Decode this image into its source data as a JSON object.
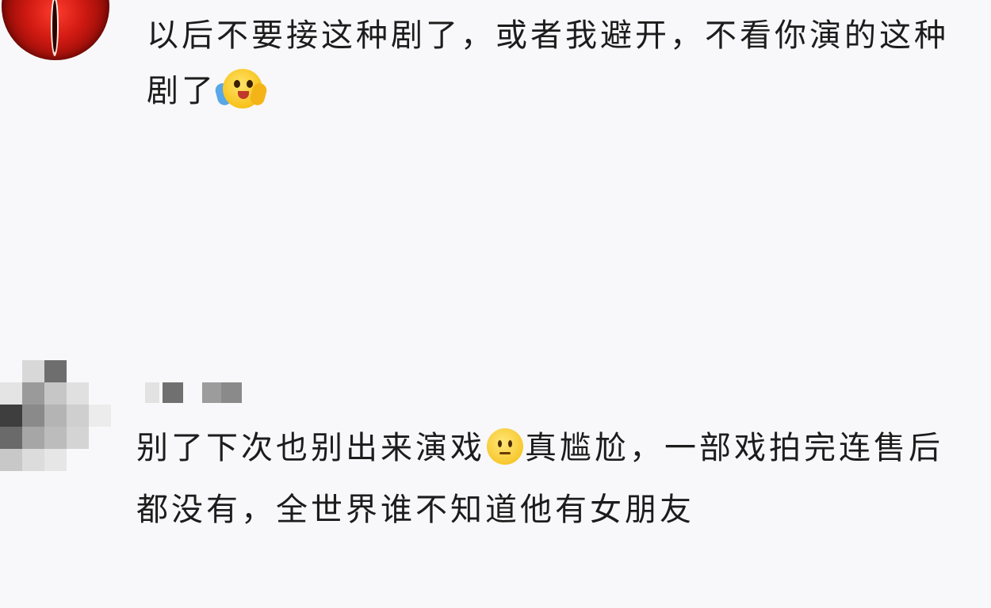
{
  "comments": [
    {
      "avatar_icon": "red-eye-avatar",
      "username": "",
      "text_parts": [
        "以后不要接这种剧了，或者我避开，不看你演的这种剧了"
      ],
      "emoji": "hugging-face-emoji"
    },
    {
      "avatar_icon": "pixelated-avatar",
      "username": "",
      "text_before_emoji": "别了下次也别出来演戏",
      "emoji": "speechless-face-emoji",
      "text_after_emoji": "真尴尬，一部戏拍完连售后都没有，全世界谁不知道他有女朋友"
    }
  ],
  "colors": {
    "background": "#f8f8fa",
    "text": "#1c1c1c"
  }
}
